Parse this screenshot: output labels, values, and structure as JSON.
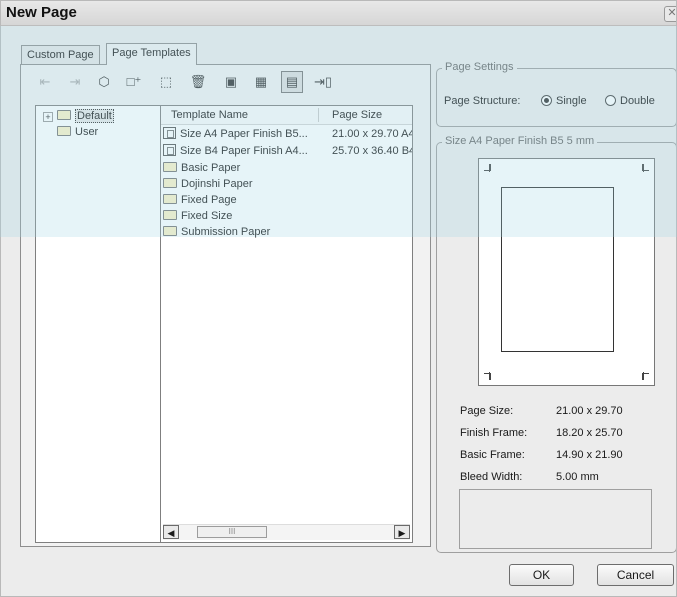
{
  "window": {
    "title": "New Page"
  },
  "tabs": [
    {
      "label": "Custom Page",
      "active": false
    },
    {
      "label": "Page Templates",
      "active": true
    }
  ],
  "toolbar": {
    "buttons": [
      {
        "icon": "import-icon",
        "enabled": false
      },
      {
        "icon": "export-icon",
        "enabled": false
      },
      {
        "icon": "register-icon",
        "enabled": true
      },
      {
        "icon": "new-template-icon",
        "enabled": true
      },
      {
        "icon": "new-folder-icon",
        "enabled": true
      },
      {
        "icon": "delete-icon",
        "enabled": true
      },
      {
        "icon": "view-thumbnails-icon",
        "enabled": true
      },
      {
        "icon": "view-list-icon",
        "enabled": true
      },
      {
        "icon": "view-details-icon",
        "enabled": true
      },
      {
        "icon": "properties-icon",
        "enabled": true
      }
    ]
  },
  "tree": {
    "items": [
      {
        "label": "Default",
        "expander": "+",
        "selected": true
      },
      {
        "label": "User"
      }
    ]
  },
  "template_list": {
    "columns": [
      "Template Name",
      "Page Size"
    ],
    "rows": [
      {
        "name": "Size A4 Paper  Finish B5...",
        "size": "21.00 x 29.70 A4",
        "type": "template"
      },
      {
        "name": "Size B4 Paper  Finish A4...",
        "size": "25.70 x 36.40 B4",
        "type": "template"
      },
      {
        "name": "Basic Paper",
        "size": "",
        "type": "folder"
      },
      {
        "name": "Dojinshi Paper",
        "size": "",
        "type": "folder"
      },
      {
        "name": "Fixed Page",
        "size": "",
        "type": "folder"
      },
      {
        "name": "Fixed Size",
        "size": "",
        "type": "folder"
      },
      {
        "name": "Submission Paper",
        "size": "",
        "type": "folder"
      }
    ],
    "scroll_thumb": "III"
  },
  "page_settings": {
    "legend": "Page Settings",
    "label": "Page Structure:",
    "options": [
      {
        "label": "Single",
        "underline": "S",
        "checked": true
      },
      {
        "label": "Double",
        "underline": "D",
        "checked": false
      }
    ]
  },
  "preview": {
    "legend": "Size A4 Paper  Finish B5 5 mm",
    "page_size_label": "Page Size:",
    "page_size_value": "21.00 x 29.70",
    "finish_frame_label": "Finish Frame:",
    "finish_frame_value": "18.20 x 25.70",
    "basic_frame_label": "Basic Frame:",
    "basic_frame_value": "14.90 x 21.90",
    "bleed_label": "Bleed Width:",
    "bleed_value": "5.00 mm"
  },
  "buttons": {
    "ok": "OK",
    "cancel": "Cancel"
  },
  "watermark": {
    "color": "#a6d8e6"
  }
}
